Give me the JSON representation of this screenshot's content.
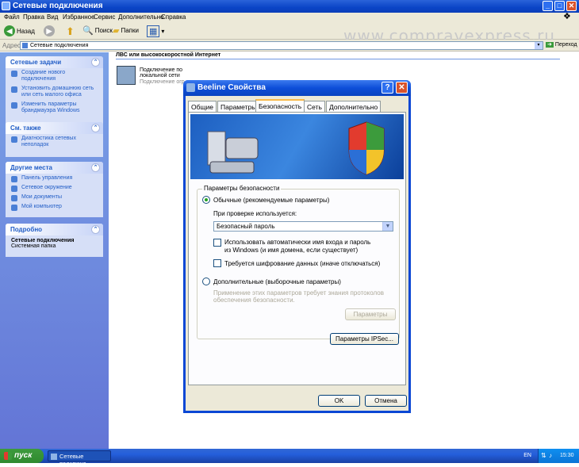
{
  "window": {
    "title": "Сетевые подключения"
  },
  "menu": [
    "Файл",
    "Правка",
    "Вид",
    "Избранное",
    "Сервис",
    "Дополнительно",
    "Справка"
  ],
  "toolbar": {
    "back": "Назад",
    "search": "Поиск",
    "folders": "Папки"
  },
  "watermark": "www.comprayexpress.ru",
  "address": {
    "label": "Адрес:",
    "value": "Сетевые подключения",
    "go": "Переход"
  },
  "sidebar": {
    "tasks": {
      "title": "Сетевые задачи",
      "items": [
        "Создание нового подключения",
        "Установить домашнюю сеть или сеть малого офиса",
        "Изменить параметры брандмауэра Windows"
      ]
    },
    "see_also": {
      "title": "См. также",
      "items": [
        "Диагностика сетевых неполадок"
      ]
    },
    "places": {
      "title": "Другие места",
      "items": [
        "Панель управления",
        "Сетевое окружение",
        "Мои документы",
        "Мой компьютер"
      ]
    },
    "details": {
      "title": "Подробно",
      "name": "Сетевые подключения",
      "type": "Системная папка"
    }
  },
  "content": {
    "section": "ЛВС или высокоскоростной Интернет",
    "conn_name": "Подключение по локальной сети",
    "conn_sub": "Подключение огр"
  },
  "dialog": {
    "title": "Beeline Свойства",
    "tabs": [
      "Общие",
      "Параметры",
      "Безопасность",
      "Сеть",
      "Дополнительно"
    ],
    "group_title": "Параметры безопасности",
    "radio_typical": "Обычные (рекомендуемые параметры)",
    "verify_label": "При проверке используется:",
    "verify_value": "Безопасный пароль",
    "chk_auto": "Использовать автоматически имя входа и пароль",
    "chk_auto2": "из Windows (и имя домена, если существует)",
    "chk_encrypt": "Требуется шифрование данных (иначе отключаться)",
    "radio_advanced": "Дополнительные (выборочные параметры)",
    "advanced_note": "Применение этих параметров требует знания протоколов обеспечения безопасности.",
    "params_button": "Параметры",
    "ipsec_button": "Параметры IPSec...",
    "ok": "OK",
    "cancel": "Отмена"
  },
  "taskbar": {
    "start": "пуск",
    "app": "Сетевые подключе...",
    "lang": "EN",
    "clock": "15:30"
  }
}
